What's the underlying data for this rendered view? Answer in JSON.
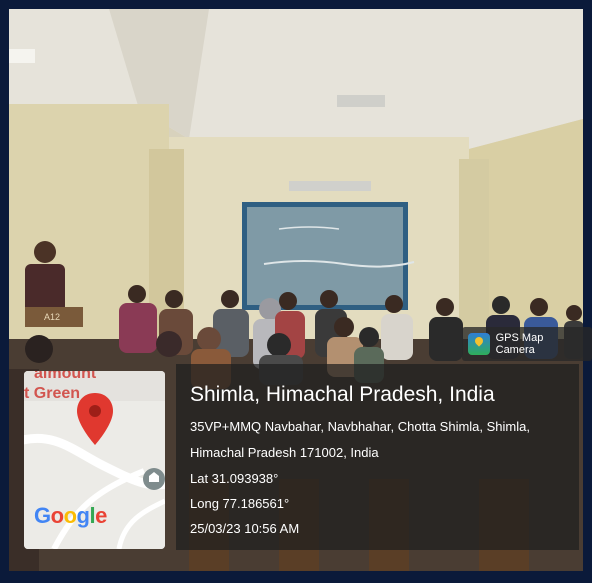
{
  "gps_badge": {
    "label": "GPS Map Camera"
  },
  "location": {
    "title": "Shimla, Himachal Pradesh, India",
    "address_line1": "35VP+MMQ Navbahar, Navbhahar, Chotta Shimla, Shimla,",
    "address_line2": "Himachal Pradesh 171002, India",
    "latitude": "Lat 31.093938°",
    "longitude": "Long 77.186561°",
    "datetime": "25/03/23 10:56 AM"
  },
  "map": {
    "label_fragment_1": "almount",
    "label_fragment_2": "t Green",
    "logo": {
      "g": "G",
      "o1": "o",
      "o2": "o",
      "g2": "g",
      "l": "l",
      "e": "e"
    },
    "colors": {
      "blue": "#4285F4",
      "red": "#EA4335",
      "yellow": "#FBBC05",
      "green": "#34A853",
      "pin": "#e0382f"
    }
  },
  "scene": {
    "podium_label": "A12"
  }
}
